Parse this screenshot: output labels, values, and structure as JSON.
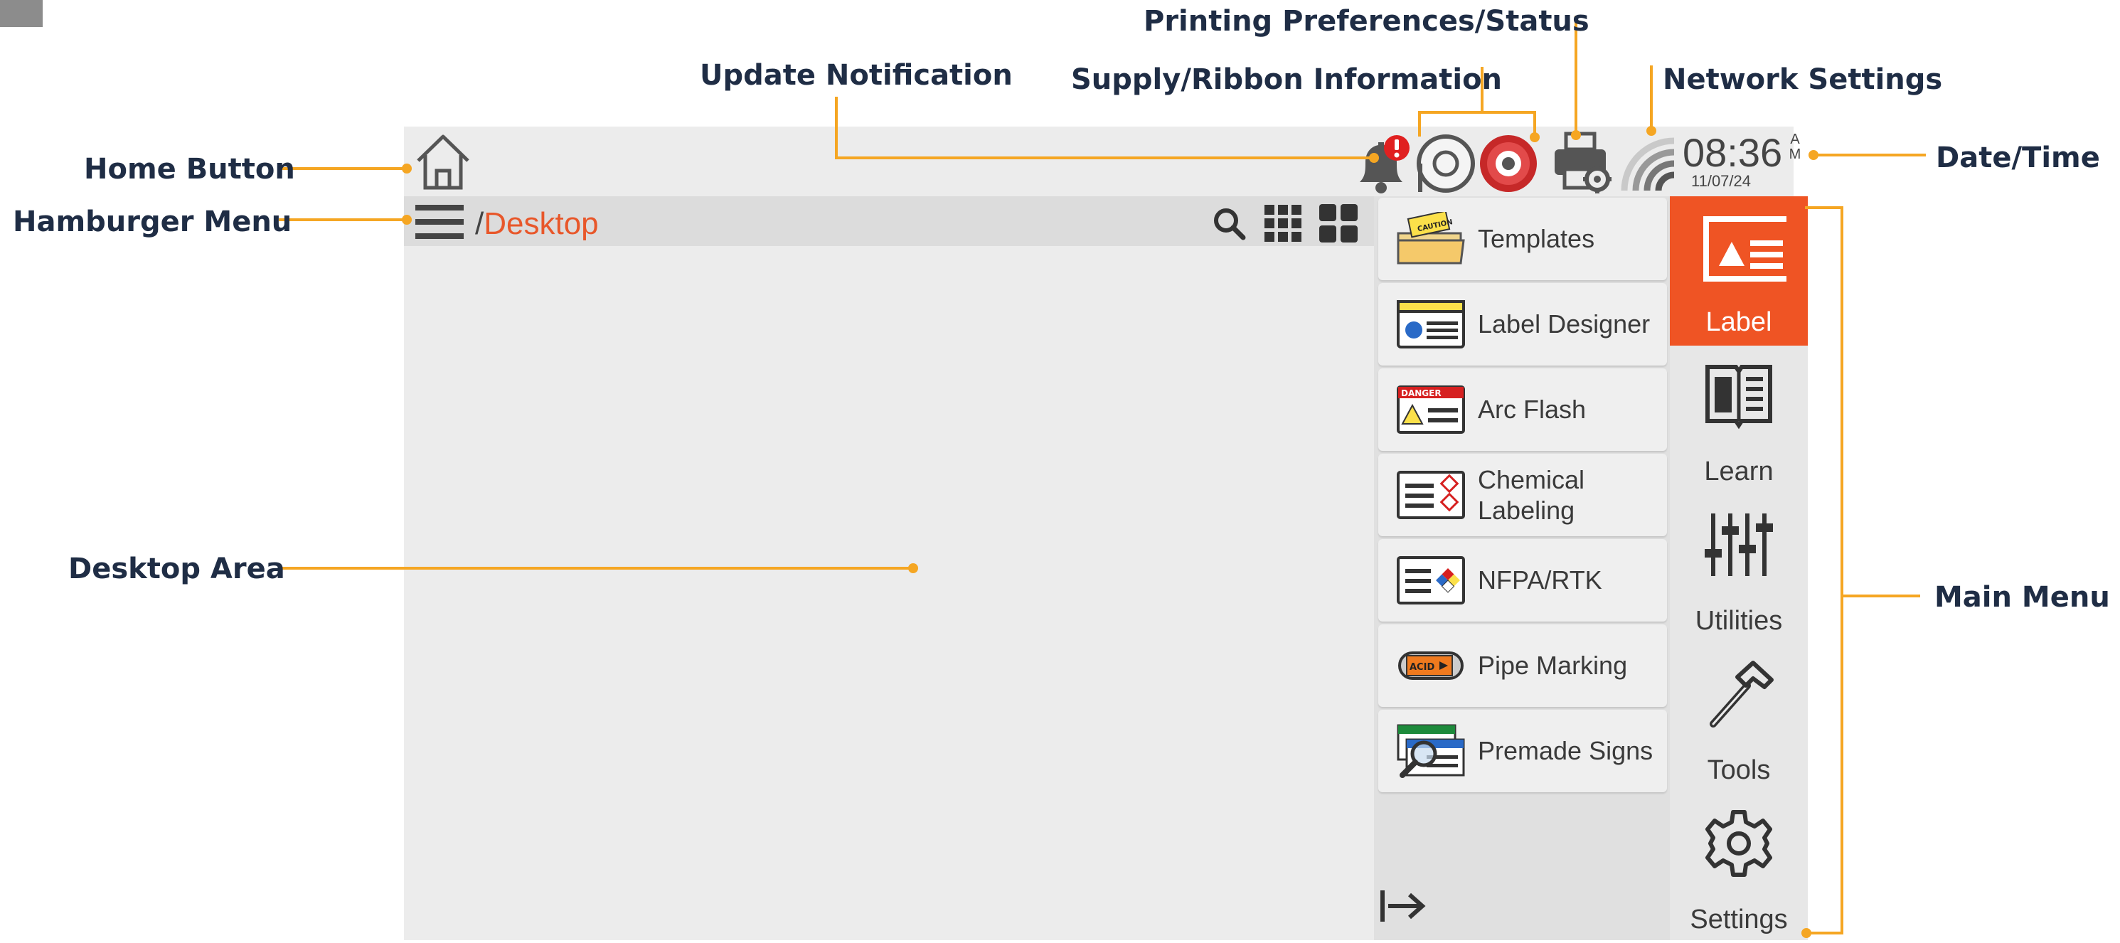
{
  "callouts": {
    "printing_preferences": "Printing Preferences/Status",
    "update_notification": "Update Notification",
    "supply_ribbon": "Supply/Ribbon Information",
    "network_settings": "Network Settings",
    "home_button": "Home Button",
    "date_time": "Date/Time",
    "hamburger_menu": "Hamburger Menu",
    "desktop_area": "Desktop Area",
    "main_menu": "Main Menu"
  },
  "breadcrumb": {
    "separator": "/",
    "current": "Desktop"
  },
  "status": {
    "time": "08:36",
    "am": "A",
    "pm": "M",
    "date": "11/07/24"
  },
  "apps": [
    {
      "label": "Templates",
      "icon": "folder-icon",
      "badge": "CAUTION"
    },
    {
      "label": "Label Designer",
      "icon": "label-designer-icon"
    },
    {
      "label": "Arc Flash",
      "icon": "arc-flash-icon",
      "badge": "DANGER"
    },
    {
      "label": "Chemical Labeling",
      "icon": "chemical-icon"
    },
    {
      "label": "NFPA/RTK",
      "icon": "nfpa-icon"
    },
    {
      "label": "Pipe Marking",
      "icon": "pipe-icon",
      "badge": "ACID"
    },
    {
      "label": "Premade Signs",
      "icon": "signs-icon"
    }
  ],
  "main_menu": [
    {
      "label": "Label",
      "icon": "label-icon",
      "active": true
    },
    {
      "label": "Learn",
      "icon": "book-icon"
    },
    {
      "label": "Utilities",
      "icon": "sliders-icon"
    },
    {
      "label": "Tools",
      "icon": "hammer-icon"
    },
    {
      "label": "Settings",
      "icon": "gear-icon"
    }
  ],
  "colors": {
    "accent": "#ef5424",
    "callout": "#f5a623",
    "text": "#1f2d45",
    "alert": "#e02020"
  }
}
